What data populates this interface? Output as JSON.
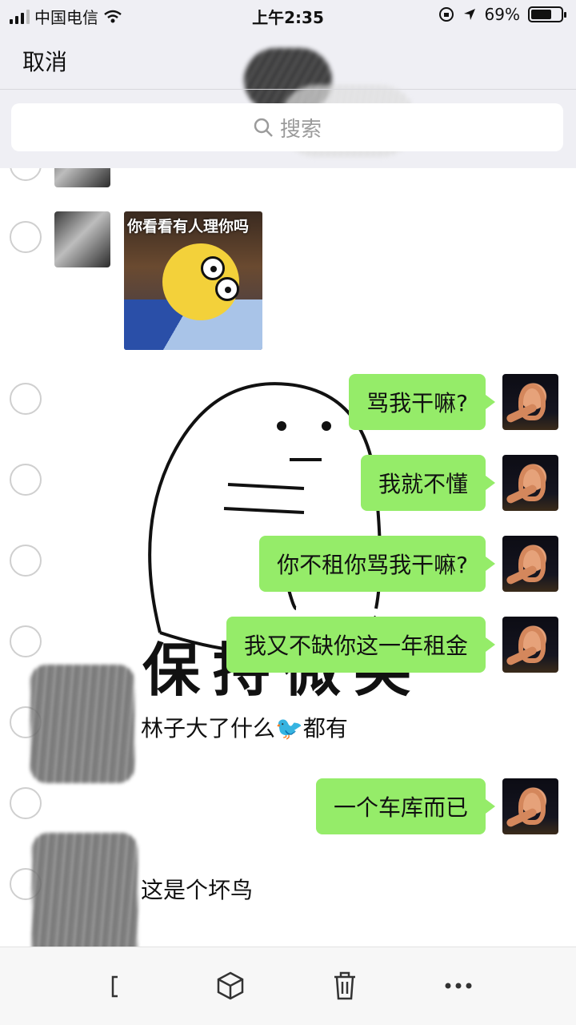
{
  "status": {
    "carrier": "中国电信",
    "time": "上午2:35",
    "battery": "69%",
    "battery_level": 0.69
  },
  "nav": {
    "cancel": "取消"
  },
  "search": {
    "placeholder": "搜索"
  },
  "messages": {
    "m1_text": "骂我干嘛?",
    "m2_text": "我就不懂",
    "m3_text": "你不租你骂我干嘛?",
    "m4_text": "我又不缺你这一年租金",
    "m5_text": "林子大了什么",
    "m5_emoji": "🐦",
    "m5_tail": "都有",
    "m6_text": "一个车库而已",
    "m7_text": "这是个坏鸟"
  },
  "sticker": {
    "caption": "你看看有人理你吗"
  },
  "background_sticker": {
    "text": "保持微笑"
  }
}
